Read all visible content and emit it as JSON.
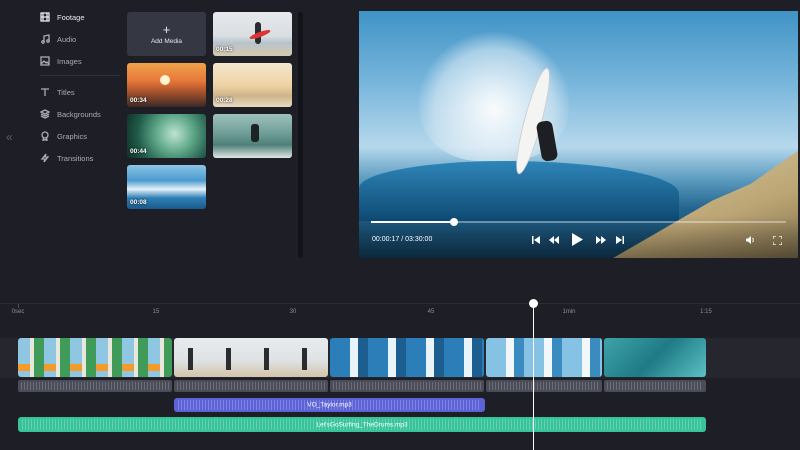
{
  "sidebar": {
    "items": [
      {
        "label": "Footage",
        "icon": "film-icon"
      },
      {
        "label": "Audio",
        "icon": "music-note-icon"
      },
      {
        "label": "Images",
        "icon": "image-icon"
      },
      {
        "label": "Titles",
        "icon": "text-icon"
      },
      {
        "label": "Backgrounds",
        "icon": "layers-icon"
      },
      {
        "label": "Graphics",
        "icon": "badge-icon"
      },
      {
        "label": "Transitions",
        "icon": "lightning-icon"
      }
    ],
    "collapse_glyph": "«"
  },
  "media": {
    "add_label": "Add Media",
    "add_glyph": "+",
    "tiles": [
      {
        "duration": "00:15"
      },
      {
        "duration": "00:34"
      },
      {
        "duration": "00:28"
      },
      {
        "duration": "00:44"
      },
      {
        "duration": ""
      },
      {
        "duration": "00:08"
      }
    ]
  },
  "player": {
    "time": "00:00:17 / 03:30:00",
    "progress": 0.2
  },
  "timeline": {
    "ticks": [
      "0sec",
      "15",
      "30",
      "45",
      "1min",
      "1:15"
    ],
    "voiceover": "VO_Taylor.mp3",
    "music": "Let'sGoSurfing_TheDrums.mp3"
  },
  "colors": {
    "background": "#1e1f26",
    "voiceover_track": "#5b63d6",
    "music_track": "#37c49b"
  }
}
